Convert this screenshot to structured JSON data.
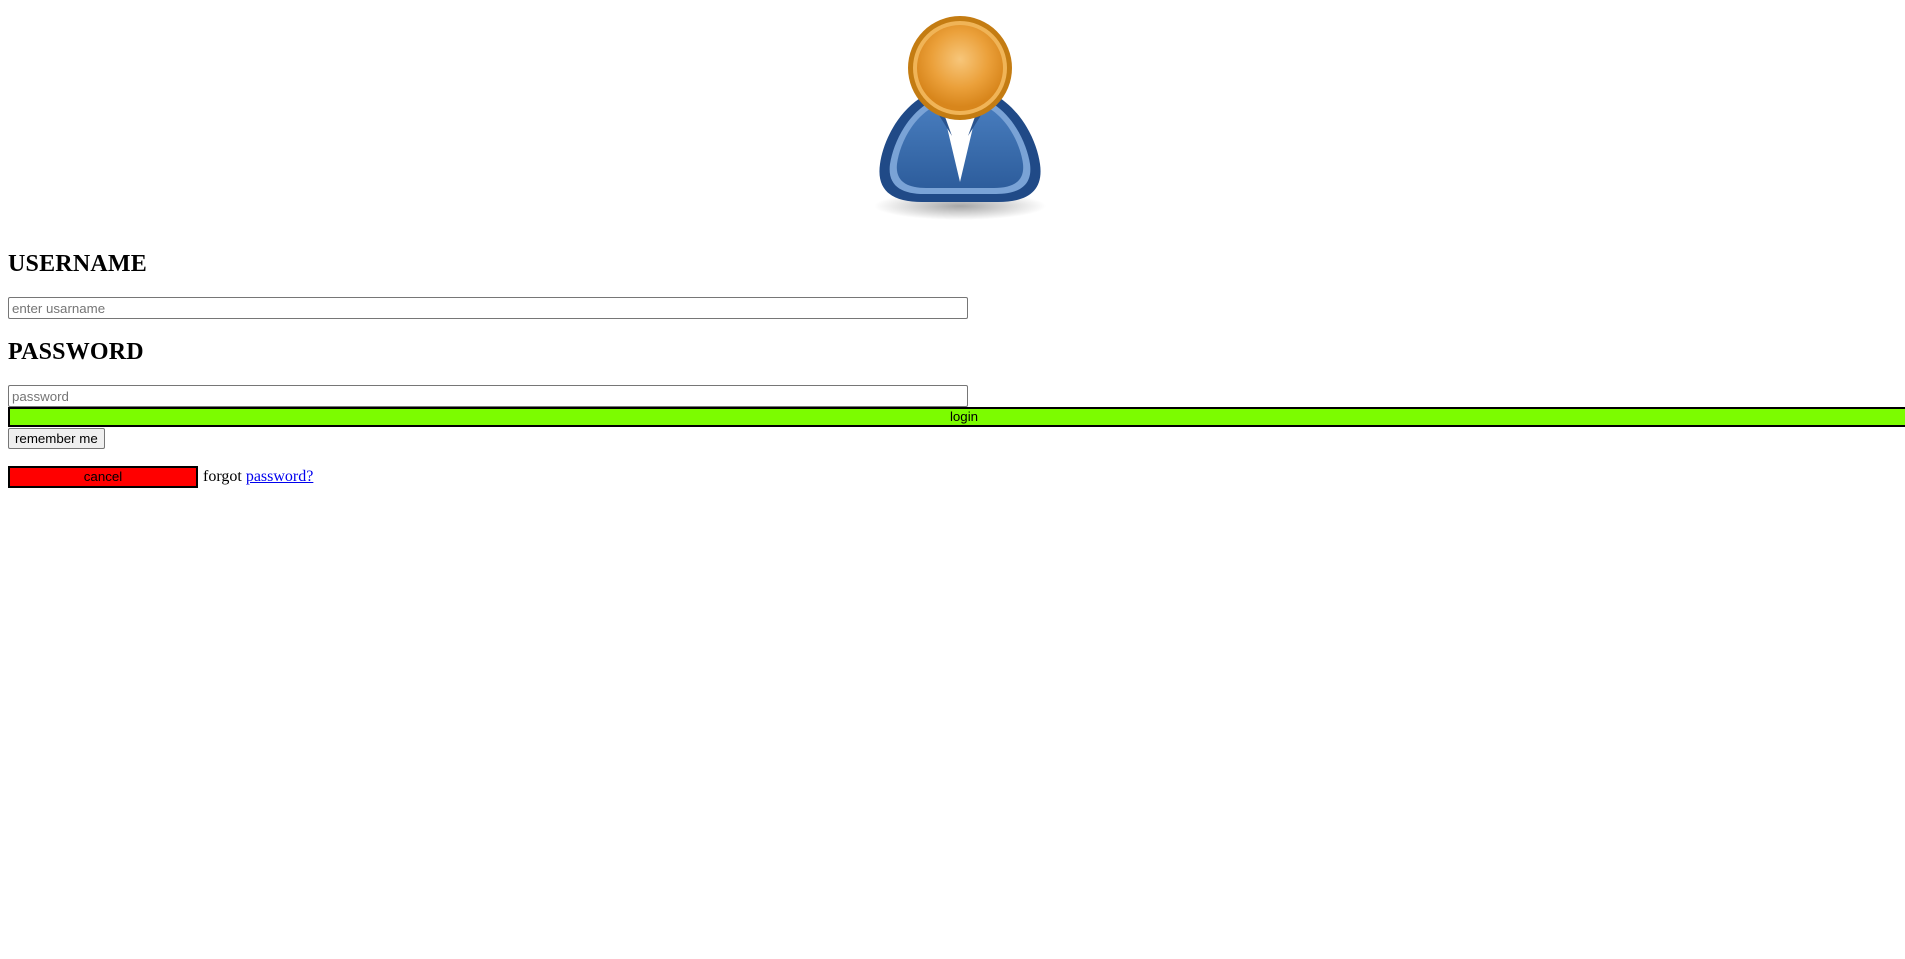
{
  "avatar": {
    "icon": "user-avatar-icon"
  },
  "username": {
    "heading": "USERNAME",
    "placeholder": "enter usarname",
    "value": ""
  },
  "password": {
    "heading": "PASSWORD",
    "placeholder": "password",
    "value": ""
  },
  "buttons": {
    "login_label": "login",
    "remember_label": "remember me",
    "cancel_label": "cancel"
  },
  "forgot": {
    "text": "forgot",
    "link_text": "password?"
  },
  "colors": {
    "login_bg": "#7cfc00",
    "cancel_bg": "#ff0000",
    "link": "#0000ee",
    "avatar_body": "#3465a4",
    "avatar_head": "#e8a33d"
  }
}
